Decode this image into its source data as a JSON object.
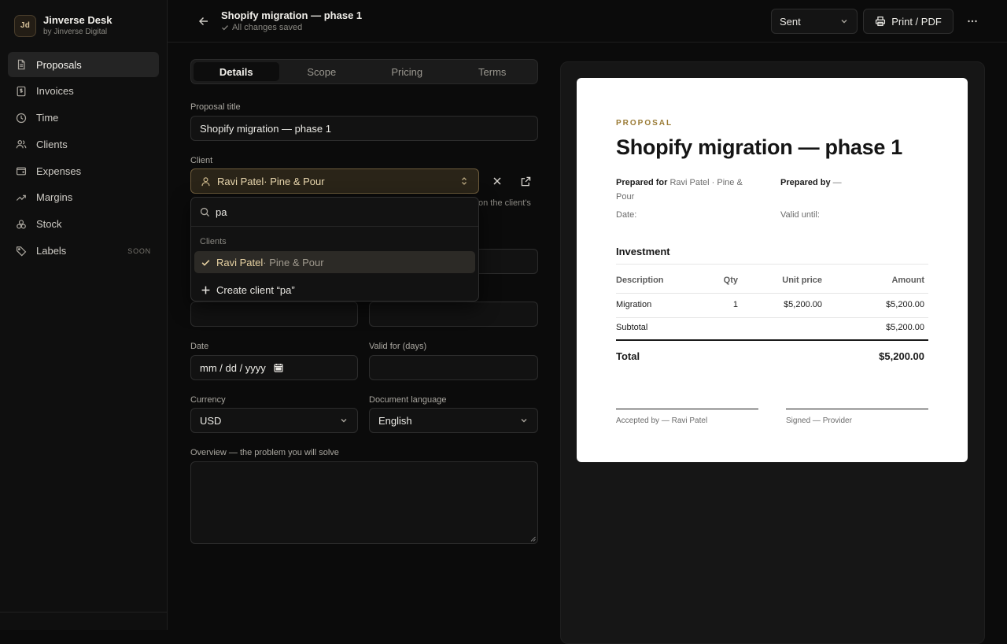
{
  "brand": {
    "initials": "Jd",
    "name": "Jinverse Desk",
    "sub": "by Jinverse Digital"
  },
  "sidebar": {
    "items": [
      {
        "label": "Proposals",
        "icon": "file-icon",
        "active": true
      },
      {
        "label": "Invoices",
        "icon": "receipt-icon"
      },
      {
        "label": "Time",
        "icon": "clock-icon"
      },
      {
        "label": "Clients",
        "icon": "users-icon"
      },
      {
        "label": "Expenses",
        "icon": "wallet-icon"
      },
      {
        "label": "Margins",
        "icon": "trend-up-icon"
      },
      {
        "label": "Stock",
        "icon": "boxes-icon"
      },
      {
        "label": "Labels",
        "icon": "tag-icon",
        "badge": "SOON"
      }
    ]
  },
  "header": {
    "title": "Shopify migration — phase 1",
    "saved": "All changes saved",
    "status": "Sent",
    "print": "Print / PDF"
  },
  "tabs": [
    "Details",
    "Scope",
    "Pricing",
    "Terms"
  ],
  "form": {
    "title_label": "Proposal title",
    "title_value": "Shopify migration — phase 1",
    "client_label": "Client",
    "client_name": "Ravi Patel",
    "client_company": " · Pine & Pour",
    "client_hint": "on the client's",
    "date_label": "Date",
    "date_placeholder": "mm / dd / yyyy",
    "valid_label": "Valid for (days)",
    "currency_label": "Currency",
    "currency_value": "USD",
    "language_label": "Document language",
    "language_value": "English",
    "overview_label": "Overview — the problem you will solve"
  },
  "dropdown": {
    "search": "pa",
    "group": "Clients",
    "option_name": "Ravi Patel",
    "option_company": " · Pine & Pour",
    "create": "Create client “pa”"
  },
  "preview": {
    "eyebrow": "PROPOSAL",
    "title": "Shopify migration — phase 1",
    "prepared_for_label": "Prepared for",
    "prepared_for_value": "Ravi Patel · Pine & Pour",
    "prepared_by_label": "Prepared by",
    "prepared_by_value": "—",
    "date_label": "Date:",
    "valid_label": "Valid until:",
    "section": "Investment",
    "columns": [
      "Description",
      "Qty",
      "Unit price",
      "Amount"
    ],
    "rows": [
      {
        "desc": "Migration",
        "qty": "1",
        "unit": "$5,200.00",
        "amount": "$5,200.00"
      }
    ],
    "subtotal_label": "Subtotal",
    "subtotal_value": "$5,200.00",
    "total_label": "Total",
    "total_value": "$5,200.00",
    "accepted": "Accepted by — Ravi Patel",
    "signed": "Signed — Provider"
  },
  "colors": {
    "accent": "#9a7b35",
    "selected_fill": "#2a2418",
    "selected_border": "#6e5c3c"
  }
}
